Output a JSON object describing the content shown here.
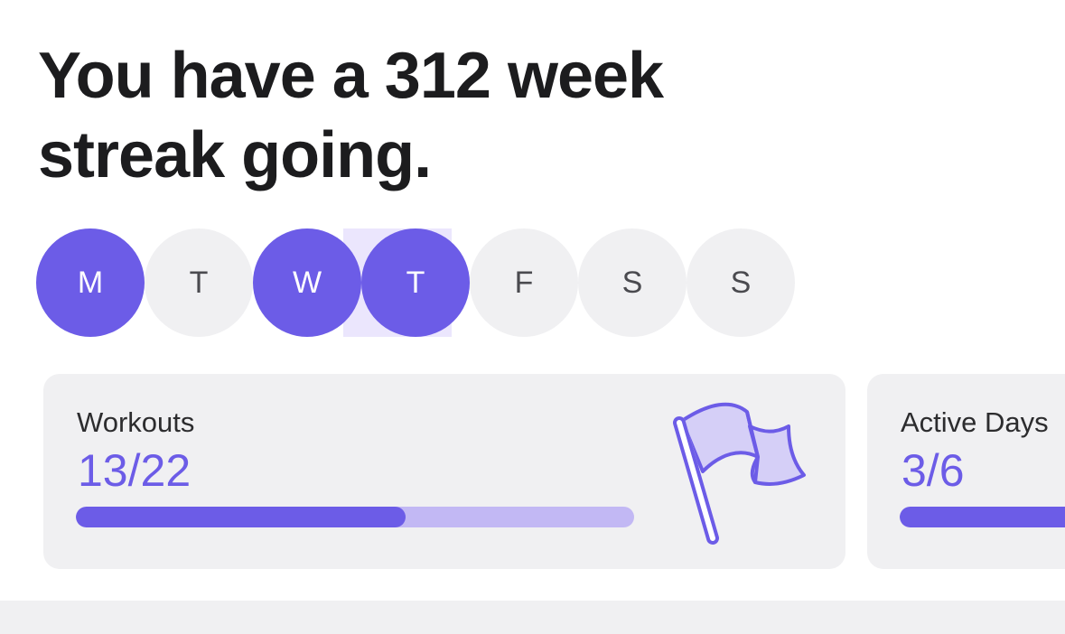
{
  "streak": {
    "headline": "You have a 312 week streak going."
  },
  "week": {
    "days": [
      {
        "label": "M",
        "done": true
      },
      {
        "label": "T",
        "done": false
      },
      {
        "label": "W",
        "done": true
      },
      {
        "label": "T",
        "done": true
      },
      {
        "label": "F",
        "done": false
      },
      {
        "label": "S",
        "done": false
      },
      {
        "label": "S",
        "done": false
      }
    ]
  },
  "cards": {
    "workouts": {
      "label": "Workouts",
      "value": "13/22",
      "progress": 0.59,
      "icon": "flag-icon"
    },
    "active_days": {
      "label": "Active Days",
      "value": "3/6",
      "progress": 0.5
    }
  },
  "colors": {
    "accent": "#6c5ce7",
    "accent_light": "#c2b8f4",
    "streak_highlight": "#ebe6fd",
    "card_background": "#f0f0f2"
  }
}
